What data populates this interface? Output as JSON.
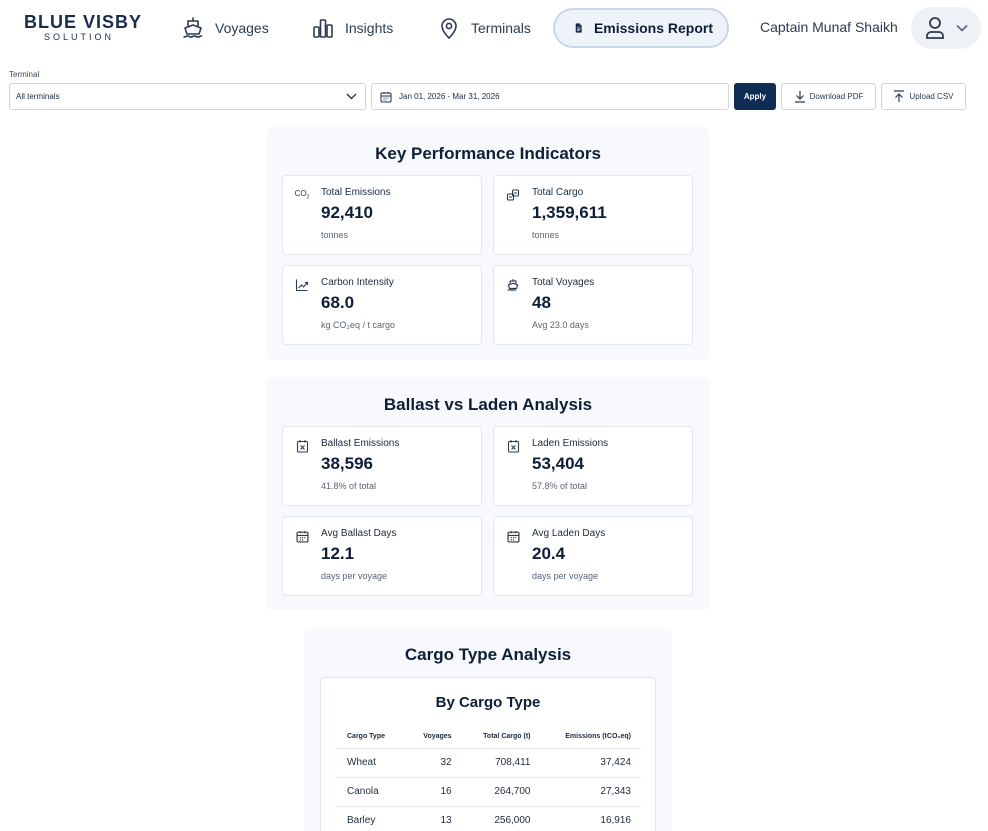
{
  "brand": {
    "name": "BLUE VISBY",
    "tagline": "SOLUTION"
  },
  "nav": {
    "items": [
      {
        "label": "Voyages",
        "icon": "ship-icon"
      },
      {
        "label": "Insights",
        "icon": "bar-chart-icon"
      },
      {
        "label": "Terminals",
        "icon": "map-pin-icon"
      },
      {
        "label": "Emissions Report",
        "icon": "document-icon",
        "active": true
      }
    ],
    "user_name": "Captain Munaf Shaikh"
  },
  "filters": {
    "terminal_label": "Terminal",
    "terminal_value": "All terminals",
    "date_range": "Jan 01, 2026 - Mar 31, 2026",
    "apply_label": "Apply",
    "download_label": "Download PDF",
    "upload_label": "Upload CSV"
  },
  "kpi": {
    "title": "Key Performance Indicators",
    "cards": [
      {
        "label": "Total Emissions",
        "value": "92,410",
        "sub": "tonnes",
        "icon": "co2-icon"
      },
      {
        "label": "Total Cargo",
        "value": "1,359,611",
        "sub": "tonnes",
        "icon": "cargo-icon"
      },
      {
        "label": "Carbon Intensity",
        "value": "68.0",
        "sub": "kg CO₂eq / t cargo",
        "icon": "trend-icon"
      },
      {
        "label": "Total Voyages",
        "value": "48",
        "sub": "Avg 23.0 days",
        "icon": "ship-icon"
      }
    ]
  },
  "ballast": {
    "title": "Ballast vs Laden Analysis",
    "cards": [
      {
        "label": "Ballast Emissions",
        "value": "38,596",
        "sub": "41.8% of total",
        "icon": "emission-icon"
      },
      {
        "label": "Laden Emissions",
        "value": "53,404",
        "sub": "57.8% of total",
        "icon": "emission-icon"
      },
      {
        "label": "Avg Ballast Days",
        "value": "12.1",
        "sub": "days per voyage",
        "icon": "calendar-icon"
      },
      {
        "label": "Avg Laden Days",
        "value": "20.4",
        "sub": "days per voyage",
        "icon": "calendar-icon"
      }
    ]
  },
  "cargo": {
    "title": "Cargo Type Analysis",
    "subtitle": "By Cargo Type",
    "columns": [
      "Cargo Type",
      "Voyages",
      "Total Cargo (t)",
      "Emissions (tCO₂eq)"
    ],
    "rows": [
      {
        "type": "Wheat",
        "voyages": "32",
        "cargo": "708,411",
        "emissions": "37,424"
      },
      {
        "type": "Canola",
        "voyages": "16",
        "cargo": "264,700",
        "emissions": "27,343"
      },
      {
        "type": "Barley",
        "voyages": "13",
        "cargo": "256,000",
        "emissions": "16,916"
      }
    ]
  },
  "colors": {
    "primary": "#0f2d54",
    "active_nav_bg": "#eef3fa",
    "panel_bg": "#f7f9fc"
  }
}
